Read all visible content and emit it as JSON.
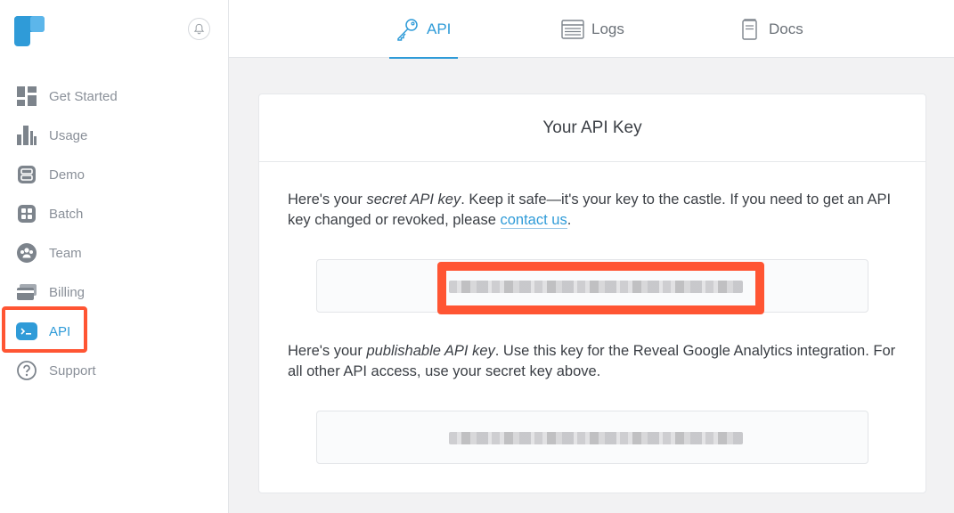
{
  "colors": {
    "accent": "#2f9bd8",
    "highlight": "#ff5533",
    "brand": "#2f9bd8"
  },
  "sidebar": {
    "items": [
      {
        "label": "Get Started",
        "icon": "dashboard-icon"
      },
      {
        "label": "Usage",
        "icon": "bar-chart-icon"
      },
      {
        "label": "Demo",
        "icon": "demo-icon"
      },
      {
        "label": "Batch",
        "icon": "batch-icon"
      },
      {
        "label": "Team",
        "icon": "team-icon"
      },
      {
        "label": "Billing",
        "icon": "credit-card-icon"
      },
      {
        "label": "API",
        "icon": "terminal-icon",
        "active": true
      },
      {
        "label": "Support",
        "icon": "help-icon"
      }
    ]
  },
  "tabs": [
    {
      "label": "API",
      "icon": "key-icon",
      "active": true
    },
    {
      "label": "Logs",
      "icon": "logs-icon"
    },
    {
      "label": "Docs",
      "icon": "docs-icon"
    }
  ],
  "card": {
    "title": "Your API Key",
    "secret": {
      "intro": "Here's your ",
      "emph": "secret API key",
      "text": ". Keep it safe—it's your key to the castle. If you need to get an API key changed or revoked, please ",
      "link": "contact us",
      "end": "."
    },
    "publishable": {
      "intro": "Here's your ",
      "emph": "publishable API key",
      "text": ". Use this key for the Reveal Google Analytics integration. For all other API access, use your secret key above."
    }
  }
}
